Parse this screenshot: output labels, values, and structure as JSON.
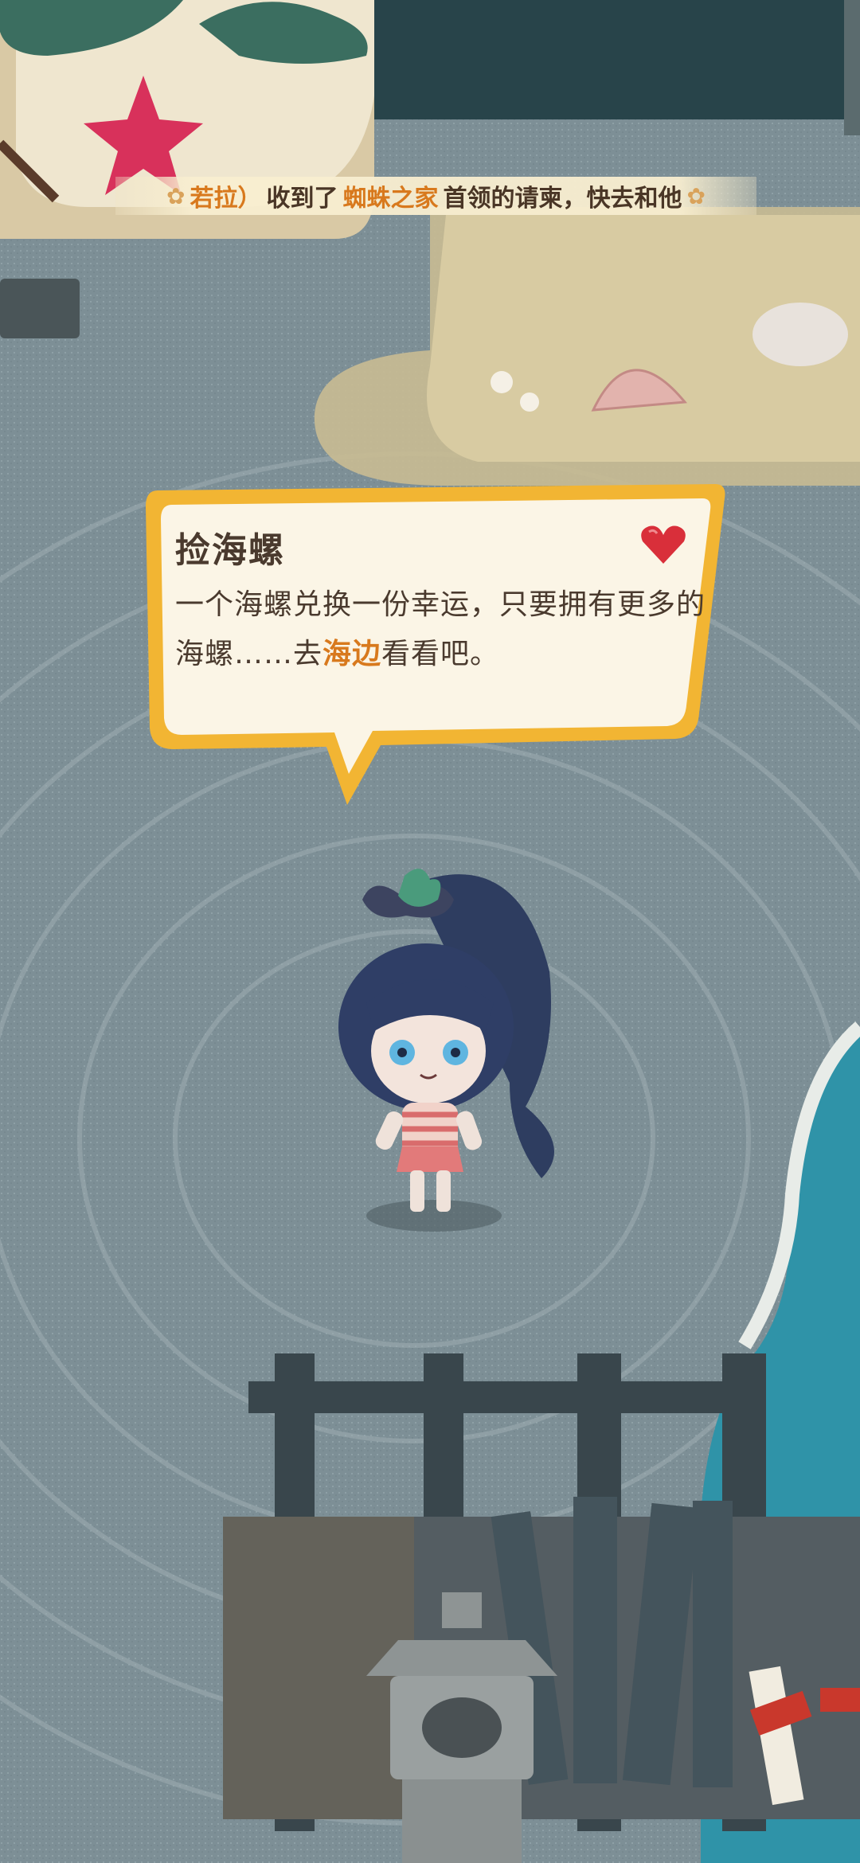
{
  "banner": {
    "text_name": "若拉）",
    "text_mid": "收到了",
    "text_place": "蜘蛛之家",
    "text_end": "首领的请柬，快去和他",
    "flower_icon": "flower-icon"
  },
  "quest": {
    "title": "捡海螺",
    "body_1": "一个海螺兑换一份幸运，只要拥有更多的海螺……去",
    "body_highlight": "海边",
    "body_2": "看看吧。",
    "heart_icon": "heart-icon"
  },
  "colors": {
    "highlight": "#d8791d",
    "bubble_border": "#f2b533",
    "bubble_fill": "#fbf5e6",
    "sand": "#e9ddb8",
    "ground": "#8a9aa0",
    "sea": "#2f93a8"
  }
}
